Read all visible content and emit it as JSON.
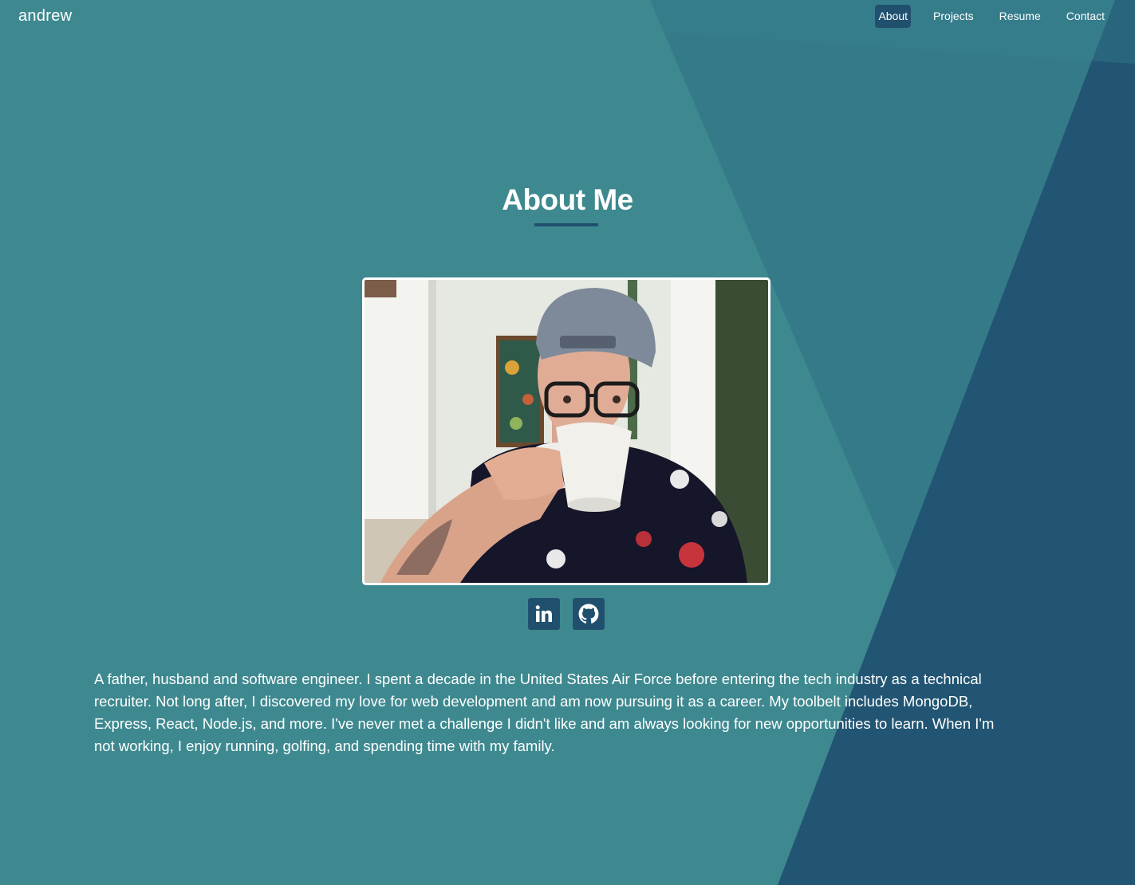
{
  "brand": {
    "name": "andrew"
  },
  "nav": {
    "items": [
      {
        "label": "About",
        "active": true
      },
      {
        "label": "Projects",
        "active": false
      },
      {
        "label": "Resume",
        "active": false
      },
      {
        "label": "Contact",
        "active": false
      }
    ]
  },
  "about": {
    "title": "About Me",
    "bio": "A father, husband and software engineer. I spent a decade in the United States Air Force before entering the tech industry as a technical recruiter. Not long after, I discovered my love for web development and am now pursuing it as a career. My toolbelt includes MongoDB, Express, React, Node.js, and more. I've never met a challenge I didn't like and am always looking for new opportunities to learn. When I'm not working, I enjoy running, golfing, and spending time with my family."
  },
  "socials": [
    {
      "icon": "linkedin-icon"
    },
    {
      "icon": "github-icon"
    }
  ],
  "colors": {
    "background": "#3e8990",
    "accent_dark": "#21506f",
    "shape_mid": "#347a88",
    "text": "#ffffff"
  }
}
